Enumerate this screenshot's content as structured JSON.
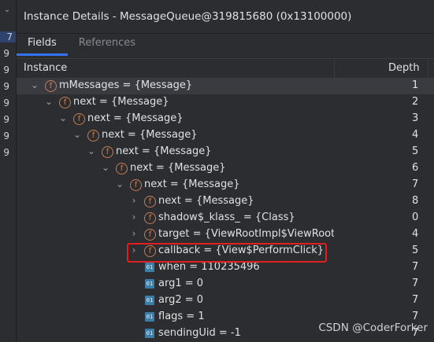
{
  "left_strip": {
    "chevron": "⌄",
    "numbers": [
      "7",
      "9",
      "9",
      "9",
      "9",
      "9",
      "9",
      "9"
    ]
  },
  "title": "Instance Details - MessageQueue@319815680 (0x13100000)",
  "tabs": [
    {
      "label": "Fields"
    },
    {
      "label": "References"
    }
  ],
  "columns": {
    "instance": "Instance",
    "depth": "Depth"
  },
  "rows": [
    {
      "expander": "⌄",
      "icon": "field",
      "label": "mMessages = {Message}",
      "depth": "1"
    },
    {
      "expander": "⌄",
      "icon": "field",
      "label": "next = {Message}",
      "depth": "2"
    },
    {
      "expander": "⌄",
      "icon": "field",
      "label": "next = {Message}",
      "depth": "3"
    },
    {
      "expander": "⌄",
      "icon": "field",
      "label": "next = {Message}",
      "depth": "4"
    },
    {
      "expander": "⌄",
      "icon": "field",
      "label": "next = {Message}",
      "depth": "5"
    },
    {
      "expander": "⌄",
      "icon": "field",
      "label": "next = {Message}",
      "depth": "6"
    },
    {
      "expander": "⌄",
      "icon": "field",
      "label": "next = {Message}",
      "depth": "7"
    },
    {
      "expander": "›",
      "icon": "field",
      "label": "next = {Message}",
      "depth": "8"
    },
    {
      "expander": "›",
      "icon": "field",
      "label": "shadow$_klass_ = {Class}",
      "depth": "0"
    },
    {
      "expander": "›",
      "icon": "field",
      "label": "target = {ViewRootImpl$ViewRootH",
      "depth": "4"
    },
    {
      "expander": "›",
      "icon": "field",
      "label": "callback = {View$PerformClick}",
      "depth": "5"
    },
    {
      "expander": "",
      "icon": "primitive",
      "label": "when = 110235496",
      "depth": "7"
    },
    {
      "expander": "",
      "icon": "primitive",
      "label": "arg1 = 0",
      "depth": "7"
    },
    {
      "expander": "",
      "icon": "primitive",
      "label": "arg2 = 0",
      "depth": "7"
    },
    {
      "expander": "",
      "icon": "primitive",
      "label": "flags = 1",
      "depth": "7"
    },
    {
      "expander": "",
      "icon": "primitive",
      "label": "sendingUid = -1",
      "depth": "7"
    }
  ],
  "icons": {
    "field_glyph": "f",
    "primitive_glyph": "01"
  },
  "watermark": "CSDN @CoderForker",
  "colors": {
    "accent": "#3574f0",
    "highlight": "#e0201e",
    "field_icon": "#c77d55",
    "primitive_icon": "#3b7ea8"
  }
}
